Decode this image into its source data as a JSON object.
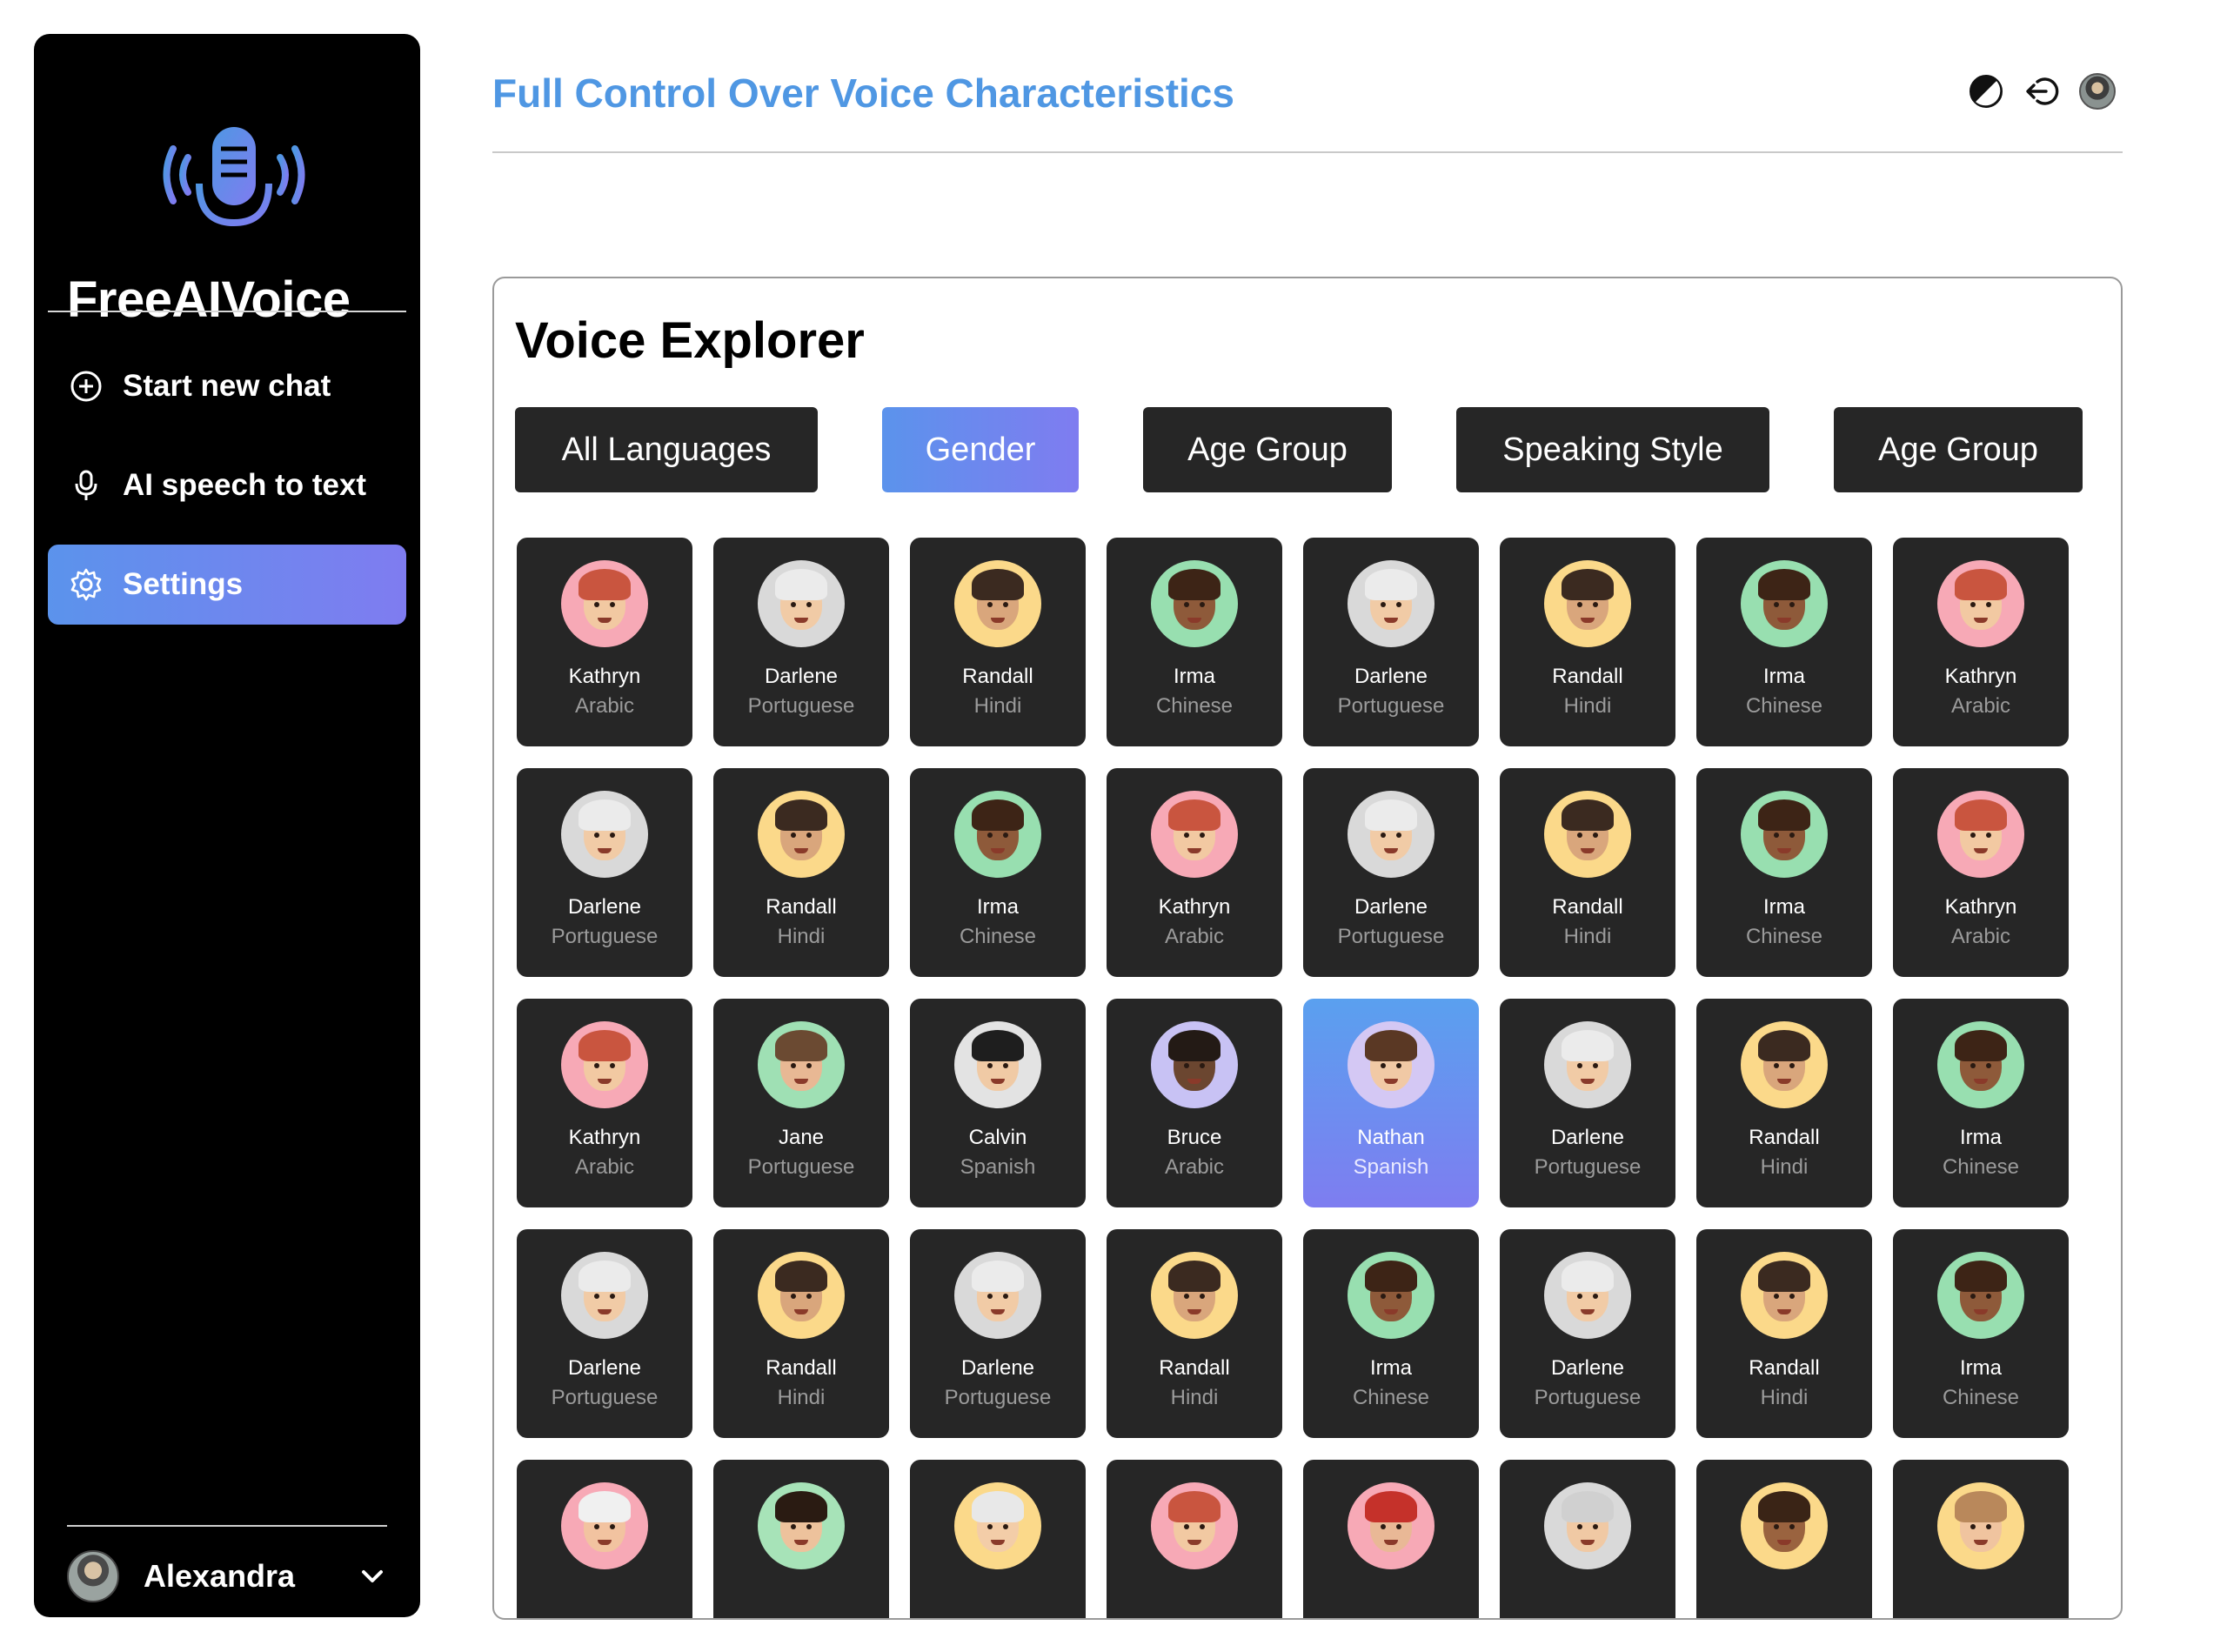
{
  "app": {
    "brand": "FreeAIVoice"
  },
  "sidebar": {
    "items": [
      {
        "label": "Start new chat",
        "icon": "plus-circle-icon"
      },
      {
        "label": "AI speech to text",
        "icon": "microphone-icon"
      },
      {
        "label": "Settings",
        "icon": "gear-icon",
        "active": true
      }
    ],
    "user": {
      "name": "Alexandra"
    }
  },
  "header": {
    "title": "Full Control Over Voice Characteristics"
  },
  "explorer": {
    "title": "Voice Explorer",
    "filters": [
      {
        "label": "All Languages",
        "active": false
      },
      {
        "label": "Gender",
        "active": true
      },
      {
        "label": "Age Group",
        "active": false
      },
      {
        "label": "Speaking Style",
        "active": false
      },
      {
        "label": "Age Group",
        "active": false
      }
    ],
    "voices": [
      {
        "name": "Kathryn",
        "lang": "Arabic",
        "bg": "#f7a9b6",
        "hair": "#c9553f",
        "skin": "#f2c9a2"
      },
      {
        "name": "Darlene",
        "lang": "Portuguese",
        "bg": "#d9d9d9",
        "hair": "#ebebeb",
        "skin": "#f1cba6"
      },
      {
        "name": "Randall",
        "lang": "Hindi",
        "bg": "#fbd98a",
        "hair": "#3b2a20",
        "skin": "#d9a67c"
      },
      {
        "name": "Irma",
        "lang": "Chinese",
        "bg": "#98dfb0",
        "hair": "#3d2416",
        "skin": "#8e5a3a"
      },
      {
        "name": "Darlene",
        "lang": "Portuguese",
        "bg": "#d9d9d9",
        "hair": "#ebebeb",
        "skin": "#f1cba6"
      },
      {
        "name": "Randall",
        "lang": "Hindi",
        "bg": "#fbd98a",
        "hair": "#3b2a20",
        "skin": "#d9a67c"
      },
      {
        "name": "Irma",
        "lang": "Chinese",
        "bg": "#98dfb0",
        "hair": "#3d2416",
        "skin": "#8e5a3a"
      },
      {
        "name": "Kathryn",
        "lang": "Arabic",
        "bg": "#f7a9b6",
        "hair": "#c9553f",
        "skin": "#f2c9a2"
      },
      {
        "name": "Darlene",
        "lang": "Portuguese",
        "bg": "#d9d9d9",
        "hair": "#ebebeb",
        "skin": "#f1cba6"
      },
      {
        "name": "Randall",
        "lang": "Hindi",
        "bg": "#fbd98a",
        "hair": "#3b2a20",
        "skin": "#d9a67c"
      },
      {
        "name": "Irma",
        "lang": "Chinese",
        "bg": "#98dfb0",
        "hair": "#3d2416",
        "skin": "#8e5a3a"
      },
      {
        "name": "Kathryn",
        "lang": "Arabic",
        "bg": "#f7a9b6",
        "hair": "#c9553f",
        "skin": "#f2c9a2"
      },
      {
        "name": "Darlene",
        "lang": "Portuguese",
        "bg": "#d9d9d9",
        "hair": "#ebebeb",
        "skin": "#f1cba6"
      },
      {
        "name": "Randall",
        "lang": "Hindi",
        "bg": "#fbd98a",
        "hair": "#3b2a20",
        "skin": "#d9a67c"
      },
      {
        "name": "Irma",
        "lang": "Chinese",
        "bg": "#98dfb0",
        "hair": "#3d2416",
        "skin": "#8e5a3a"
      },
      {
        "name": "Kathryn",
        "lang": "Arabic",
        "bg": "#f7a9b6",
        "hair": "#c9553f",
        "skin": "#f2c9a2"
      },
      {
        "name": "Kathryn",
        "lang": "Arabic",
        "bg": "#f7a9b6",
        "hair": "#c9553f",
        "skin": "#f2c9a2"
      },
      {
        "name": "Jane",
        "lang": "Portuguese",
        "bg": "#9fe0b4",
        "hair": "#6b4a32",
        "skin": "#e8b894"
      },
      {
        "name": "Calvin",
        "lang": "Spanish",
        "bg": "#e3e3e3",
        "hair": "#1e1e1e",
        "skin": "#f0caa5"
      },
      {
        "name": "Bruce",
        "lang": "Arabic",
        "bg": "#c8c2f4",
        "hair": "#231a15",
        "skin": "#6b4630"
      },
      {
        "name": "Nathan",
        "lang": "Spanish",
        "bg": "#d4c8f4",
        "hair": "#5a3824",
        "skin": "#f1c9a5",
        "active": true
      },
      {
        "name": "Darlene",
        "lang": "Portuguese",
        "bg": "#d9d9d9",
        "hair": "#ebebeb",
        "skin": "#f1cba6"
      },
      {
        "name": "Randall",
        "lang": "Hindi",
        "bg": "#fbd98a",
        "hair": "#3b2a20",
        "skin": "#d9a67c"
      },
      {
        "name": "Irma",
        "lang": "Chinese",
        "bg": "#98dfb0",
        "hair": "#3d2416",
        "skin": "#8e5a3a"
      },
      {
        "name": "Darlene",
        "lang": "Portuguese",
        "bg": "#d9d9d9",
        "hair": "#ebebeb",
        "skin": "#f1cba6"
      },
      {
        "name": "Randall",
        "lang": "Hindi",
        "bg": "#fbd98a",
        "hair": "#3b2a20",
        "skin": "#d9a67c"
      },
      {
        "name": "Darlene",
        "lang": "Portuguese",
        "bg": "#d9d9d9",
        "hair": "#ebebeb",
        "skin": "#f1cba6"
      },
      {
        "name": "Randall",
        "lang": "Hindi",
        "bg": "#fbd98a",
        "hair": "#3b2a20",
        "skin": "#d9a67c"
      },
      {
        "name": "Irma",
        "lang": "Chinese",
        "bg": "#98dfb0",
        "hair": "#3d2416",
        "skin": "#8e5a3a"
      },
      {
        "name": "Darlene",
        "lang": "Portuguese",
        "bg": "#d9d9d9",
        "hair": "#ebebeb",
        "skin": "#f1cba6"
      },
      {
        "name": "Randall",
        "lang": "Hindi",
        "bg": "#fbd98a",
        "hair": "#3b2a20",
        "skin": "#d9a67c"
      },
      {
        "name": "Irma",
        "lang": "Chinese",
        "bg": "#98dfb0",
        "hair": "#3d2416",
        "skin": "#8e5a3a"
      },
      {
        "name": "",
        "lang": "",
        "bg": "#f7a9b6",
        "hair": "#f0f0f0",
        "skin": "#f2c3a0"
      },
      {
        "name": "",
        "lang": "",
        "bg": "#a7e3b8",
        "hair": "#2a1b12",
        "skin": "#edc29c"
      },
      {
        "name": "",
        "lang": "",
        "bg": "#fbd98a",
        "hair": "#e8e8e8",
        "skin": "#f3cda8"
      },
      {
        "name": "",
        "lang": "",
        "bg": "#f7a9b6",
        "hair": "#c9553f",
        "skin": "#f2c9a2"
      },
      {
        "name": "",
        "lang": "",
        "bg": "#f7a9b6",
        "hair": "#c5312a",
        "skin": "#e9b896"
      },
      {
        "name": "",
        "lang": "",
        "bg": "#d9d9d9",
        "hair": "#d0d0d0",
        "skin": "#f0c9a4"
      },
      {
        "name": "",
        "lang": "",
        "bg": "#fbd98a",
        "hair": "#3a2416",
        "skin": "#9a633f"
      },
      {
        "name": "",
        "lang": "",
        "bg": "#fbd98a",
        "hair": "#b9885b",
        "skin": "#f0c49f"
      }
    ]
  },
  "colors": {
    "accent_start": "#5b93ec",
    "accent_end": "#7f7cf0",
    "title": "#4f97e3"
  }
}
